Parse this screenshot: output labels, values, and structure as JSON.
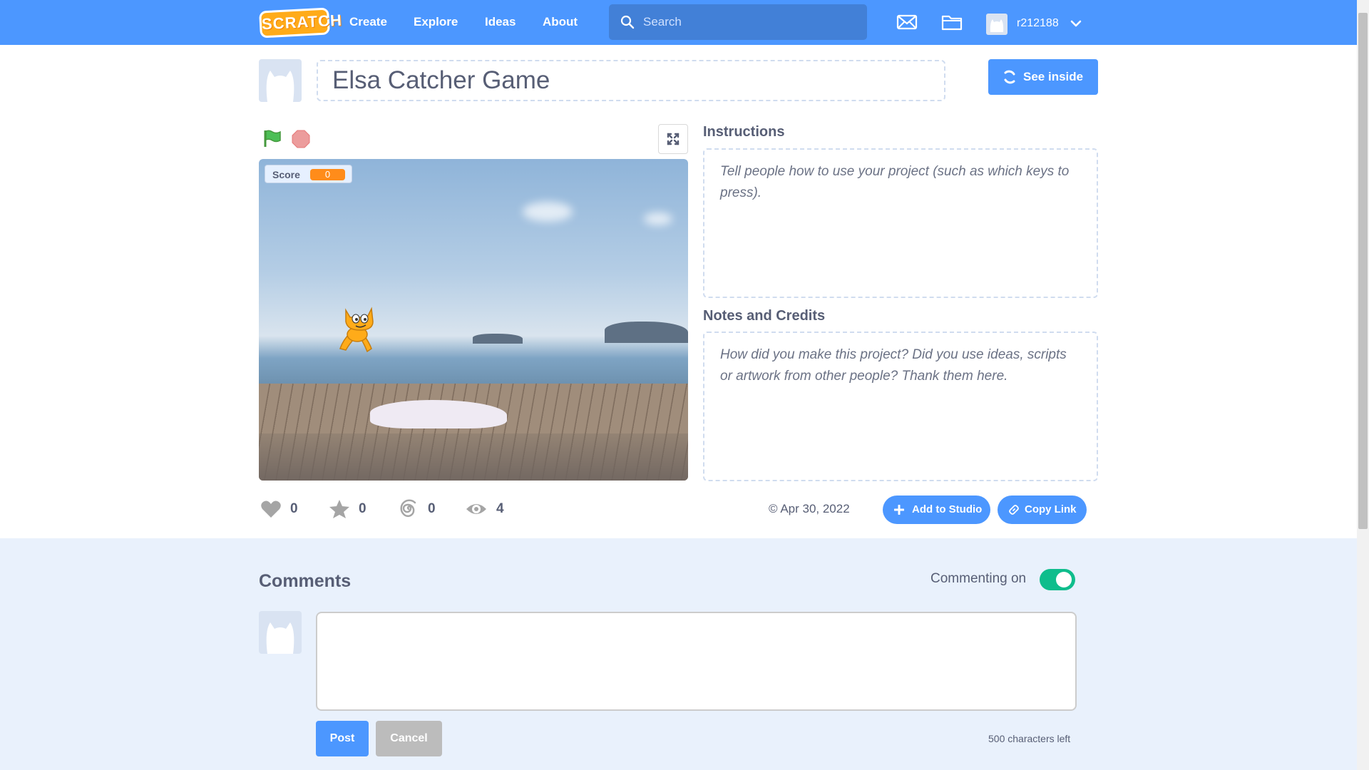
{
  "nav": {
    "logo_text": "SCRATCH",
    "links": [
      "Create",
      "Explore",
      "Ideas",
      "About"
    ],
    "search_placeholder": "Search",
    "username": "r212188",
    "icons": [
      "messages-icon",
      "my-stuff-folder-icon",
      "chevron-down-icon"
    ]
  },
  "project": {
    "title": "Elsa Catcher Game",
    "see_inside_label": "See inside"
  },
  "player": {
    "score_label": "Score",
    "score_value": "0"
  },
  "instructions": {
    "heading": "Instructions",
    "placeholder": "Tell people how to use your project (such as which keys to press)."
  },
  "notes": {
    "heading": "Notes and Credits",
    "placeholder": "How did you make this project? Did you use ideas, scripts or artwork from other people? Thank them here."
  },
  "stats": {
    "loves": "0",
    "favorites": "0",
    "remixes": "0",
    "views": "4",
    "date": "Apr 30, 2022",
    "add_to_studio_label": "Add to Studio",
    "copy_link_label": "Copy Link"
  },
  "comments": {
    "title": "Comments",
    "commenting_label": "Commenting on",
    "commenting_enabled": true,
    "post_label": "Post",
    "cancel_label": "Cancel",
    "chars_left": "500 characters left"
  },
  "colors": {
    "brand_blue": "#4c97ff",
    "toggle_green": "#0fbd8c",
    "score_orange": "#ff8c1a"
  }
}
